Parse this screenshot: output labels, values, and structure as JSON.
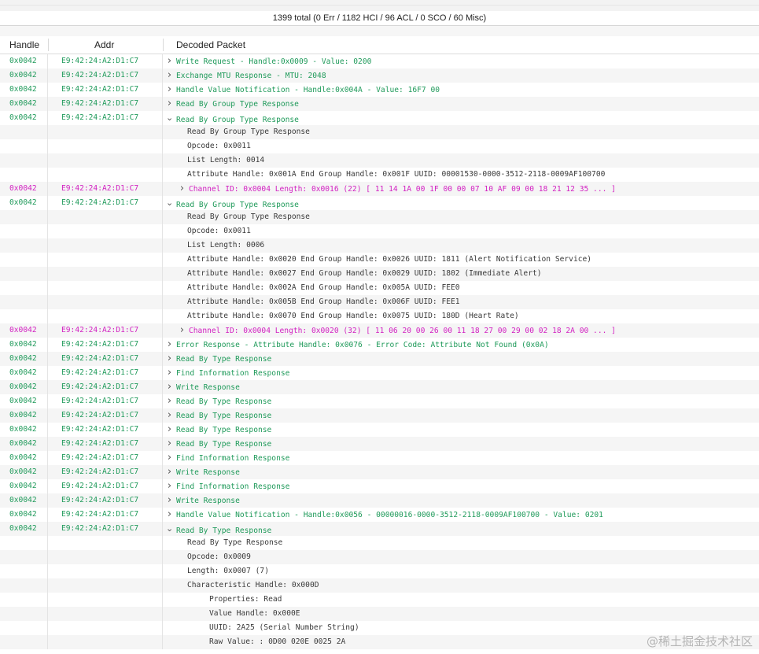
{
  "summary": "1399 total (0 Err / 1182 HCI / 96 ACL / 0 SCO / 60 Misc)",
  "columns": {
    "handle": "Handle",
    "addr": "Addr",
    "packet": "Decoded Packet"
  },
  "colors": {
    "green": "#1f9a5a",
    "magenta": "#d21fc1"
  },
  "rows": [
    {
      "handle": "0x0042",
      "addr": "E9:42:24:A2:D1:C7",
      "chev": ">",
      "indent": 0,
      "color": "green",
      "text": "Write Request - Handle:0x0009 - Value: 0200"
    },
    {
      "handle": "0x0042",
      "addr": "E9:42:24:A2:D1:C7",
      "chev": ">",
      "indent": 0,
      "color": "green",
      "text": "Exchange MTU Response - MTU: 2048"
    },
    {
      "handle": "0x0042",
      "addr": "E9:42:24:A2:D1:C7",
      "chev": ">",
      "indent": 0,
      "color": "green",
      "text": "Handle Value Notification - Handle:0x004A - Value: 16F7 00"
    },
    {
      "handle": "0x0042",
      "addr": "E9:42:24:A2:D1:C7",
      "chev": ">",
      "indent": 0,
      "color": "green",
      "text": "Read By Group Type Response"
    },
    {
      "handle": "0x0042",
      "addr": "E9:42:24:A2:D1:C7",
      "chev": "v",
      "indent": 0,
      "color": "green",
      "text": "Read By Group Type Response"
    },
    {
      "handle": "",
      "addr": "",
      "chev": "",
      "indent": 1,
      "color": "detail",
      "text": "Read By Group Type Response"
    },
    {
      "handle": "",
      "addr": "",
      "chev": "",
      "indent": 1,
      "color": "detail",
      "text": "Opcode: 0x0011"
    },
    {
      "handle": "",
      "addr": "",
      "chev": "",
      "indent": 1,
      "color": "detail",
      "text": "List Length: 0014"
    },
    {
      "handle": "",
      "addr": "",
      "chev": "",
      "indent": 1,
      "color": "detail",
      "text": "Attribute Handle: 0x001A End Group Handle: 0x001F UUID: 00001530-0000-3512-2118-0009AF100700"
    },
    {
      "handle": "0x0042",
      "addr": "E9:42:24:A2:D1:C7",
      "chev": ">",
      "indent": 1,
      "color": "magenta",
      "text": "Channel ID: 0x0004  Length: 0x0016 (22) [ 11 14 1A 00 1F 00 00 07 10 AF 09 00 18 21 12 35 ... ]"
    },
    {
      "handle": "0x0042",
      "addr": "E9:42:24:A2:D1:C7",
      "chev": "v",
      "indent": 0,
      "color": "green",
      "text": "Read By Group Type Response"
    },
    {
      "handle": "",
      "addr": "",
      "chev": "",
      "indent": 1,
      "color": "detail",
      "text": "Read By Group Type Response"
    },
    {
      "handle": "",
      "addr": "",
      "chev": "",
      "indent": 1,
      "color": "detail",
      "text": "Opcode: 0x0011"
    },
    {
      "handle": "",
      "addr": "",
      "chev": "",
      "indent": 1,
      "color": "detail",
      "text": "List Length: 0006"
    },
    {
      "handle": "",
      "addr": "",
      "chev": "",
      "indent": 1,
      "color": "detail",
      "text": "Attribute Handle: 0x0020 End Group Handle: 0x0026 UUID: 1811 (Alert Notification Service)"
    },
    {
      "handle": "",
      "addr": "",
      "chev": "",
      "indent": 1,
      "color": "detail",
      "text": "Attribute Handle: 0x0027 End Group Handle: 0x0029 UUID: 1802 (Immediate Alert)"
    },
    {
      "handle": "",
      "addr": "",
      "chev": "",
      "indent": 1,
      "color": "detail",
      "text": "Attribute Handle: 0x002A End Group Handle: 0x005A UUID: FEE0"
    },
    {
      "handle": "",
      "addr": "",
      "chev": "",
      "indent": 1,
      "color": "detail",
      "text": "Attribute Handle: 0x005B End Group Handle: 0x006F UUID: FEE1"
    },
    {
      "handle": "",
      "addr": "",
      "chev": "",
      "indent": 1,
      "color": "detail",
      "text": "Attribute Handle: 0x0070 End Group Handle: 0x0075 UUID: 180D (Heart Rate)"
    },
    {
      "handle": "0x0042",
      "addr": "E9:42:24:A2:D1:C7",
      "chev": ">",
      "indent": 1,
      "color": "magenta",
      "text": "Channel ID: 0x0004  Length: 0x0020 (32) [ 11 06 20 00 26 00 11 18 27 00 29 00 02 18 2A 00 ... ]"
    },
    {
      "handle": "0x0042",
      "addr": "E9:42:24:A2:D1:C7",
      "chev": ">",
      "indent": 0,
      "color": "green",
      "text": "Error Response - Attribute Handle: 0x0076 - Error Code: Attribute Not Found (0x0A)"
    },
    {
      "handle": "0x0042",
      "addr": "E9:42:24:A2:D1:C7",
      "chev": ">",
      "indent": 0,
      "color": "green",
      "text": "Read By Type Response"
    },
    {
      "handle": "0x0042",
      "addr": "E9:42:24:A2:D1:C7",
      "chev": ">",
      "indent": 0,
      "color": "green",
      "text": "Find Information Response"
    },
    {
      "handle": "0x0042",
      "addr": "E9:42:24:A2:D1:C7",
      "chev": ">",
      "indent": 0,
      "color": "green",
      "text": "Write Response"
    },
    {
      "handle": "0x0042",
      "addr": "E9:42:24:A2:D1:C7",
      "chev": ">",
      "indent": 0,
      "color": "green",
      "text": "Read By Type Response"
    },
    {
      "handle": "0x0042",
      "addr": "E9:42:24:A2:D1:C7",
      "chev": ">",
      "indent": 0,
      "color": "green",
      "text": "Read By Type Response"
    },
    {
      "handle": "0x0042",
      "addr": "E9:42:24:A2:D1:C7",
      "chev": ">",
      "indent": 0,
      "color": "green",
      "text": "Read By Type Response"
    },
    {
      "handle": "0x0042",
      "addr": "E9:42:24:A2:D1:C7",
      "chev": ">",
      "indent": 0,
      "color": "green",
      "text": "Read By Type Response"
    },
    {
      "handle": "0x0042",
      "addr": "E9:42:24:A2:D1:C7",
      "chev": ">",
      "indent": 0,
      "color": "green",
      "text": "Find Information Response"
    },
    {
      "handle": "0x0042",
      "addr": "E9:42:24:A2:D1:C7",
      "chev": ">",
      "indent": 0,
      "color": "green",
      "text": "Write Response"
    },
    {
      "handle": "0x0042",
      "addr": "E9:42:24:A2:D1:C7",
      "chev": ">",
      "indent": 0,
      "color": "green",
      "text": "Find Information Response"
    },
    {
      "handle": "0x0042",
      "addr": "E9:42:24:A2:D1:C7",
      "chev": ">",
      "indent": 0,
      "color": "green",
      "text": "Write Response"
    },
    {
      "handle": "0x0042",
      "addr": "E9:42:24:A2:D1:C7",
      "chev": ">",
      "indent": 0,
      "color": "green",
      "text": "Handle Value Notification - Handle:0x0056 - 00000016-0000-3512-2118-0009AF100700 - Value: 0201"
    },
    {
      "handle": "0x0042",
      "addr": "E9:42:24:A2:D1:C7",
      "chev": "v",
      "indent": 0,
      "color": "green",
      "text": "Read By Type Response"
    },
    {
      "handle": "",
      "addr": "",
      "chev": "",
      "indent": 1,
      "color": "detail",
      "text": "Read By Type Response"
    },
    {
      "handle": "",
      "addr": "",
      "chev": "",
      "indent": 1,
      "color": "detail",
      "text": "Opcode: 0x0009"
    },
    {
      "handle": "",
      "addr": "",
      "chev": "",
      "indent": 1,
      "color": "detail",
      "text": "Length: 0x0007 (7)"
    },
    {
      "handle": "",
      "addr": "",
      "chev": "",
      "indent": 1,
      "color": "detail",
      "text": "Characteristic Handle: 0x000D"
    },
    {
      "handle": "",
      "addr": "",
      "chev": "",
      "indent": 2,
      "color": "detail",
      "text": "Properties: Read"
    },
    {
      "handle": "",
      "addr": "",
      "chev": "",
      "indent": 2,
      "color": "detail",
      "text": "Value Handle: 0x000E"
    },
    {
      "handle": "",
      "addr": "",
      "chev": "",
      "indent": 2,
      "color": "detail",
      "text": "UUID: 2A25 (Serial Number String)"
    },
    {
      "handle": "",
      "addr": "",
      "chev": "",
      "indent": 2,
      "color": "detail",
      "text": "Raw Value: : 0D00 020E 0025 2A"
    }
  ],
  "watermark": "@稀土掘金技术社区"
}
